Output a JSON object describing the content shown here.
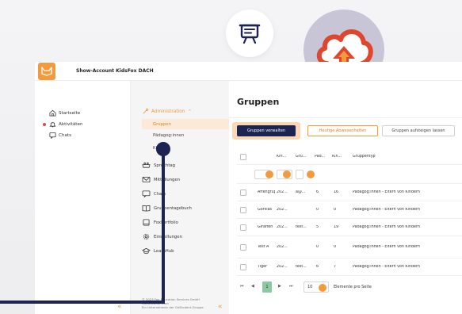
{
  "app": {
    "account_name": "Show-Account KidsFox DACH"
  },
  "left_nav": {
    "items": [
      {
        "label": "Startseite",
        "icon": "home-icon"
      },
      {
        "label": "Aktivitäten",
        "icon": "bell-icon"
      },
      {
        "label": "Chats",
        "icon": "chat-icon"
      }
    ],
    "collapse": "«"
  },
  "sub_nav": {
    "section": "Administration",
    "sub_items": [
      "Gruppen",
      "Pädagog:innen",
      "Kinder"
    ],
    "items": [
      {
        "label": "Sprechtag",
        "icon": "meeting-icon"
      },
      {
        "label": "Mitteilungen",
        "icon": "mail-icon"
      },
      {
        "label": "Chats",
        "icon": "chat-icon"
      },
      {
        "label": "Gruppentagebuch",
        "icon": "book-icon"
      },
      {
        "label": "FoxPortfolio",
        "icon": "portfolio-icon"
      },
      {
        "label": "Einstellungen",
        "icon": "gear-icon"
      },
      {
        "label": "LearnHub",
        "icon": "graduation-cap-icon"
      }
    ],
    "footer": [
      "© 2023 Fox Education Services GmbH",
      "foxeducation.com",
      "Ein Unternehmen der GoStudent-Gruppe"
    ],
    "collapse": "«"
  },
  "main": {
    "title": "Gruppen",
    "buttons": {
      "manage": "Gruppen verwalten",
      "absences": "Heutige Abwesenheiten",
      "promote": "Gruppen aufsteigen lassen"
    },
    "table": {
      "headers": [
        "Kin...",
        "Gru...",
        "Päd...",
        "Kin...",
        "Gruppentyp"
      ],
      "rows": [
        {
          "name": "Affengruppe",
          "year": "202...",
          "group": "a@...",
          "ped": "6",
          "kids": "16",
          "type": "Pädagog:innen - Eltern von Kindern"
        },
        {
          "name": "Gorillas",
          "year": "202...",
          "group": "",
          "ped": "0",
          "kids": "0",
          "type": "Pädagog:innen - Eltern von Kindern"
        },
        {
          "name": "Giraffen",
          "year": "202...",
          "group": "test...",
          "ped": "5",
          "kids": "19",
          "type": "Pädagog:innen - Eltern von Kindern"
        },
        {
          "name": "Test A",
          "year": "202...",
          "group": "",
          "ped": "0",
          "kids": "0",
          "type": "Pädagog:innen - Eltern von Kindern"
        },
        {
          "name": "Tiger",
          "year": "202...",
          "group": "test...",
          "ped": "6",
          "kids": "7",
          "type": "Pädagog:innen - Eltern von Kindern"
        }
      ]
    },
    "pagination": {
      "first": "⏮",
      "prev": "◀",
      "current": "1",
      "next": "▶",
      "last": "⏭",
      "page_size": "10",
      "page_size_label": "Elemente pro Seite"
    }
  },
  "colors": {
    "brand_orange": "#f39a3d",
    "navy": "#1c2452",
    "highlight": "#fde9d8",
    "cloud_bg": "#c8c6d6",
    "arrow_red": "#e0452e"
  },
  "floating_icons": [
    "presentation-icon",
    "cloud-upload-icon"
  ]
}
